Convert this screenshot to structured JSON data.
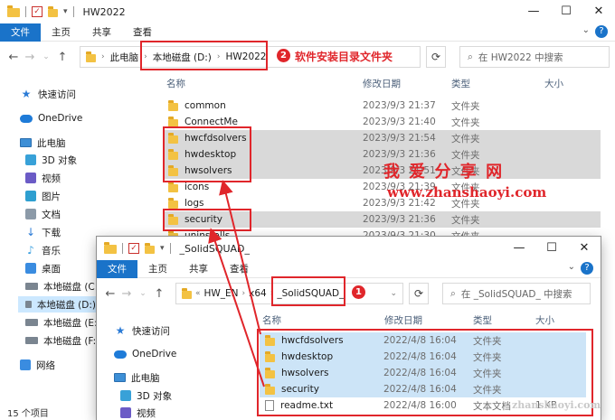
{
  "back_window": {
    "title": "HW2022",
    "ribbon_tabs": [
      "文件",
      "主页",
      "共享",
      "查看"
    ],
    "address": {
      "crumbs": [
        "此电脑",
        "本地磁盘 (D:)",
        "HW2022"
      ]
    },
    "annotation_num": "2",
    "annotation_text": "软件安装目录文件夹",
    "search_placeholder": "在 HW2022 中搜索",
    "columns": {
      "name": "名称",
      "date": "修改日期",
      "type": "类型",
      "size": "大小"
    },
    "files": [
      {
        "name": "common",
        "date": "2023/9/3 21:37",
        "type": "文件夹"
      },
      {
        "name": "ConnectMe",
        "date": "2023/9/3 21:40",
        "type": "文件夹"
      },
      {
        "name": "hwcfdsolvers",
        "date": "2023/9/3 21:54",
        "type": "文件夹"
      },
      {
        "name": "hwdesktop",
        "date": "2023/9/3 21:36",
        "type": "文件夹"
      },
      {
        "name": "hwsolvers",
        "date": "2023/9/3 21:51",
        "type": "文件夹"
      },
      {
        "name": "icons",
        "date": "2023/9/3 21:39",
        "type": "文件夹"
      },
      {
        "name": "logs",
        "date": "2023/9/3 21:42",
        "type": "文件夹"
      },
      {
        "name": "security",
        "date": "2023/9/3 21:36",
        "type": "文件夹"
      },
      {
        "name": "uninstalls",
        "date": "2023/9/3 21:30",
        "type": "文件夹"
      }
    ],
    "sidebar": [
      {
        "label": "快速访问",
        "icon": "star-icon"
      },
      {
        "label": "OneDrive",
        "icon": "cloud-icon"
      },
      {
        "label": "此电脑",
        "icon": "computer-icon"
      },
      {
        "label": "3D 对象",
        "icon": "3d-objects-icon"
      },
      {
        "label": "视频",
        "icon": "video-icon"
      },
      {
        "label": "图片",
        "icon": "pictures-icon"
      },
      {
        "label": "文档",
        "icon": "documents-icon"
      },
      {
        "label": "下载",
        "icon": "download-icon"
      },
      {
        "label": "音乐",
        "icon": "music-icon"
      },
      {
        "label": "桌面",
        "icon": "desktop-icon"
      },
      {
        "label": "本地磁盘 (C:)",
        "icon": "drive-icon"
      },
      {
        "label": "本地磁盘 (D:)",
        "icon": "drive-icon"
      },
      {
        "label": "本地磁盘 (E:)",
        "icon": "drive-icon"
      },
      {
        "label": "本地磁盘 (F:)",
        "icon": "drive-icon"
      },
      {
        "label": "网络",
        "icon": "network-icon"
      }
    ],
    "status": "15 个项目"
  },
  "front_window": {
    "title": "_SolidSQUAD_",
    "ribbon_tabs": [
      "文件",
      "主页",
      "共享",
      "查看"
    ],
    "address": {
      "prefix": "«",
      "crumbs": [
        "HW_EN",
        "x64",
        "_SolidSQUAD_"
      ]
    },
    "annotation_num": "1",
    "search_placeholder": "在 _SolidSQUAD_ 中搜索",
    "columns": {
      "name": "名称",
      "date": "修改日期",
      "type": "类型",
      "size": "大小"
    },
    "files": [
      {
        "name": "hwcfdsolvers",
        "date": "2022/4/8 16:04",
        "type": "文件夹",
        "size": ""
      },
      {
        "name": "hwdesktop",
        "date": "2022/4/8 16:04",
        "type": "文件夹",
        "size": ""
      },
      {
        "name": "hwsolvers",
        "date": "2022/4/8 16:04",
        "type": "文件夹",
        "size": ""
      },
      {
        "name": "security",
        "date": "2022/4/8 16:04",
        "type": "文件夹",
        "size": ""
      },
      {
        "name": "readme.txt",
        "date": "2022/4/8 16:00",
        "type": "文本文档",
        "size": "1 KB"
      }
    ],
    "sidebar": [
      {
        "label": "快速访问",
        "icon": "star-icon"
      },
      {
        "label": "OneDrive",
        "icon": "cloud-icon"
      },
      {
        "label": "此电脑",
        "icon": "computer-icon"
      },
      {
        "label": "3D 对象",
        "icon": "3d-objects-icon"
      },
      {
        "label": "视频",
        "icon": "video-icon"
      }
    ]
  },
  "watermark": {
    "brand": "我 爱 分 享 网",
    "url": "www.zhanshaoyi.com",
    "url_small": "zhanshaoyi.com"
  },
  "accent_color": "#1a73c9",
  "annotation_color": "#e0262b"
}
